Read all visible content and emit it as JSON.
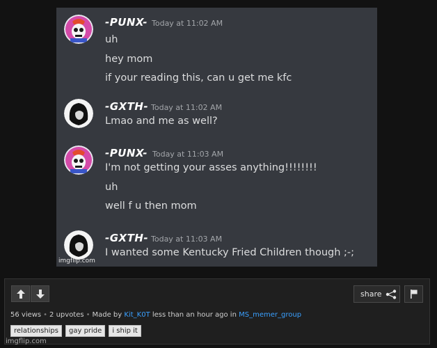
{
  "messages": [
    {
      "user": "-PUNX-",
      "time": "Today at 11:02 AM",
      "avatar": "skull-avatar",
      "lines": [
        "uh",
        "hey mom",
        "if your reading this, can u get me kfc"
      ]
    },
    {
      "user": "-GXTH-",
      "time": "Today at 11:02 AM",
      "avatar": "goth-avatar",
      "lines": [
        "Lmao and me as well?"
      ]
    },
    {
      "user": "-PUNX-",
      "time": "Today at 11:03 AM",
      "avatar": "skull-avatar",
      "lines": [
        "I'm not getting your asses anything!!!!!!!!",
        "uh",
        "well f u then mom"
      ]
    },
    {
      "user": "-GXTH-",
      "time": "Today at 11:03 AM",
      "avatar": "goth-avatar",
      "lines": [
        "I wanted some Kentucky Fried Children though ;-;"
      ]
    }
  ],
  "image_watermark": "imgflip.com",
  "actions": {
    "upvote_icon": "arrow-up-icon",
    "downvote_icon": "arrow-down-icon",
    "share_label": "share",
    "share_icon": "share-icon",
    "flag_icon": "flag-icon"
  },
  "meta": {
    "views": "56 views",
    "upvotes": "2 upvotes",
    "made_by_prefix": "Made by",
    "author": "Kit_K0T",
    "time": "less than an hour ago in",
    "stream": "MS_memer_group"
  },
  "tags": [
    "relationships",
    "gay pride",
    "i ship it"
  ],
  "footer_watermark": "imgflip.com",
  "colors": {
    "discord_bg": "#36393f",
    "link": "#3aa0ff",
    "page_bg": "#121212"
  }
}
